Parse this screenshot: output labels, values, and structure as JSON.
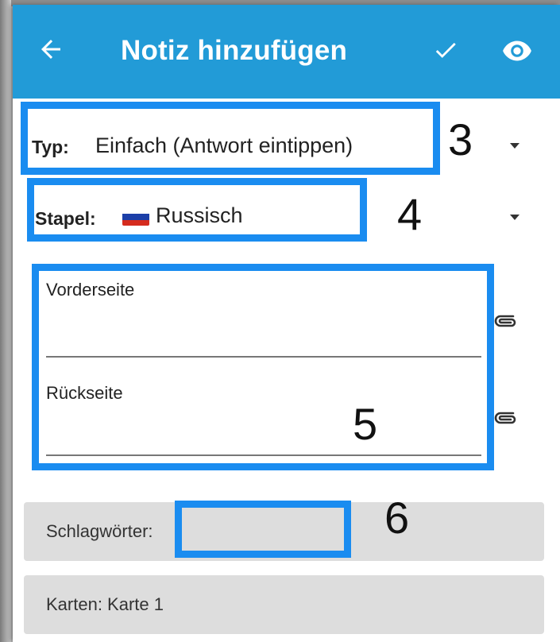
{
  "appbar": {
    "title": "Notiz hinzufügen",
    "back_icon": "arrow-left-icon",
    "confirm_icon": "check-icon",
    "preview_icon": "eye-icon",
    "color": "#229bd7"
  },
  "type_selector": {
    "label": "Typ:",
    "value": "Einfach (Antwort eintippen)"
  },
  "deck_selector": {
    "label": "Stapel:",
    "value": "Russisch",
    "flag_icon": "russia-flag-icon"
  },
  "fields": [
    {
      "label": "Vorderseite",
      "value": ""
    },
    {
      "label": "Rückseite",
      "value": ""
    }
  ],
  "tags_bar": {
    "label": "Schlagwörter:"
  },
  "cards_bar": {
    "label": "Karten: Karte 1"
  },
  "annotations": {
    "n3": "3",
    "n4": "4",
    "n5": "5",
    "n6": "6",
    "highlight_color": "#1a8cf0"
  }
}
